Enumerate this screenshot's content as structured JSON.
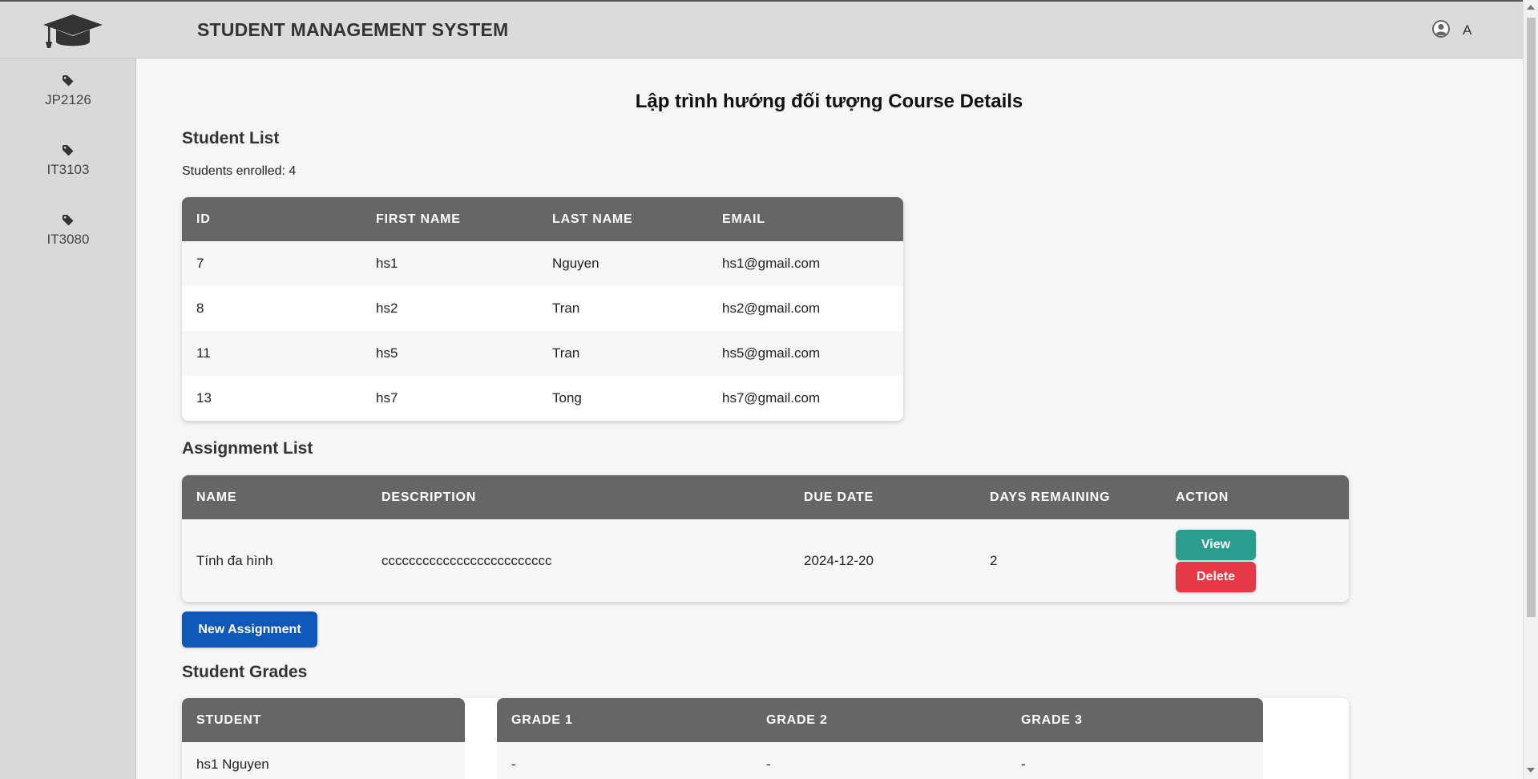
{
  "header": {
    "title": "STUDENT MANAGEMENT SYSTEM",
    "user_name": "A"
  },
  "sidebar": {
    "items": [
      {
        "label": "JP2126",
        "icon": "tag-icon"
      },
      {
        "label": "IT3103",
        "icon": "tag-icon"
      },
      {
        "label": "IT3080",
        "icon": "tag-icon"
      }
    ]
  },
  "main": {
    "page_title": "Lập trình hướng đối tượng Course Details",
    "student_list": {
      "title": "Student List",
      "enrolled_text": "Students enrolled: 4",
      "columns": [
        "ID",
        "FIRST NAME",
        "LAST NAME",
        "EMAIL"
      ],
      "rows": [
        [
          "7",
          "hs1",
          "Nguyen",
          "hs1@gmail.com"
        ],
        [
          "8",
          "hs2",
          "Tran",
          "hs2@gmail.com"
        ],
        [
          "11",
          "hs5",
          "Tran",
          "hs5@gmail.com"
        ],
        [
          "13",
          "hs7",
          "Tong",
          "hs7@gmail.com"
        ]
      ]
    },
    "assignment_list": {
      "title": "Assignment List",
      "columns": [
        "NAME",
        "DESCRIPTION",
        "DUE DATE",
        "DAYS REMAINING",
        "ACTION"
      ],
      "rows": [
        {
          "name": "Tính đa hình",
          "description": "ccccccccccccccccccccccccc",
          "due_date": "2024-12-20",
          "days_remaining": "2",
          "view_label": "View",
          "delete_label": "Delete"
        }
      ],
      "new_button_label": "New Assignment"
    },
    "student_grades": {
      "title": "Student Grades",
      "student_column": "STUDENT",
      "grade_columns": [
        "GRADE 1",
        "GRADE 2",
        "GRADE 3"
      ],
      "rows": [
        {
          "student": "hs1 Nguyen",
          "grades": [
            "-",
            "-",
            "-"
          ]
        }
      ]
    }
  },
  "colors": {
    "header_bg": "#dbdbdb",
    "table_header": "#666666",
    "view_button": "#2a9d8f",
    "delete_button": "#e63946",
    "new_button": "#0d58b8"
  }
}
